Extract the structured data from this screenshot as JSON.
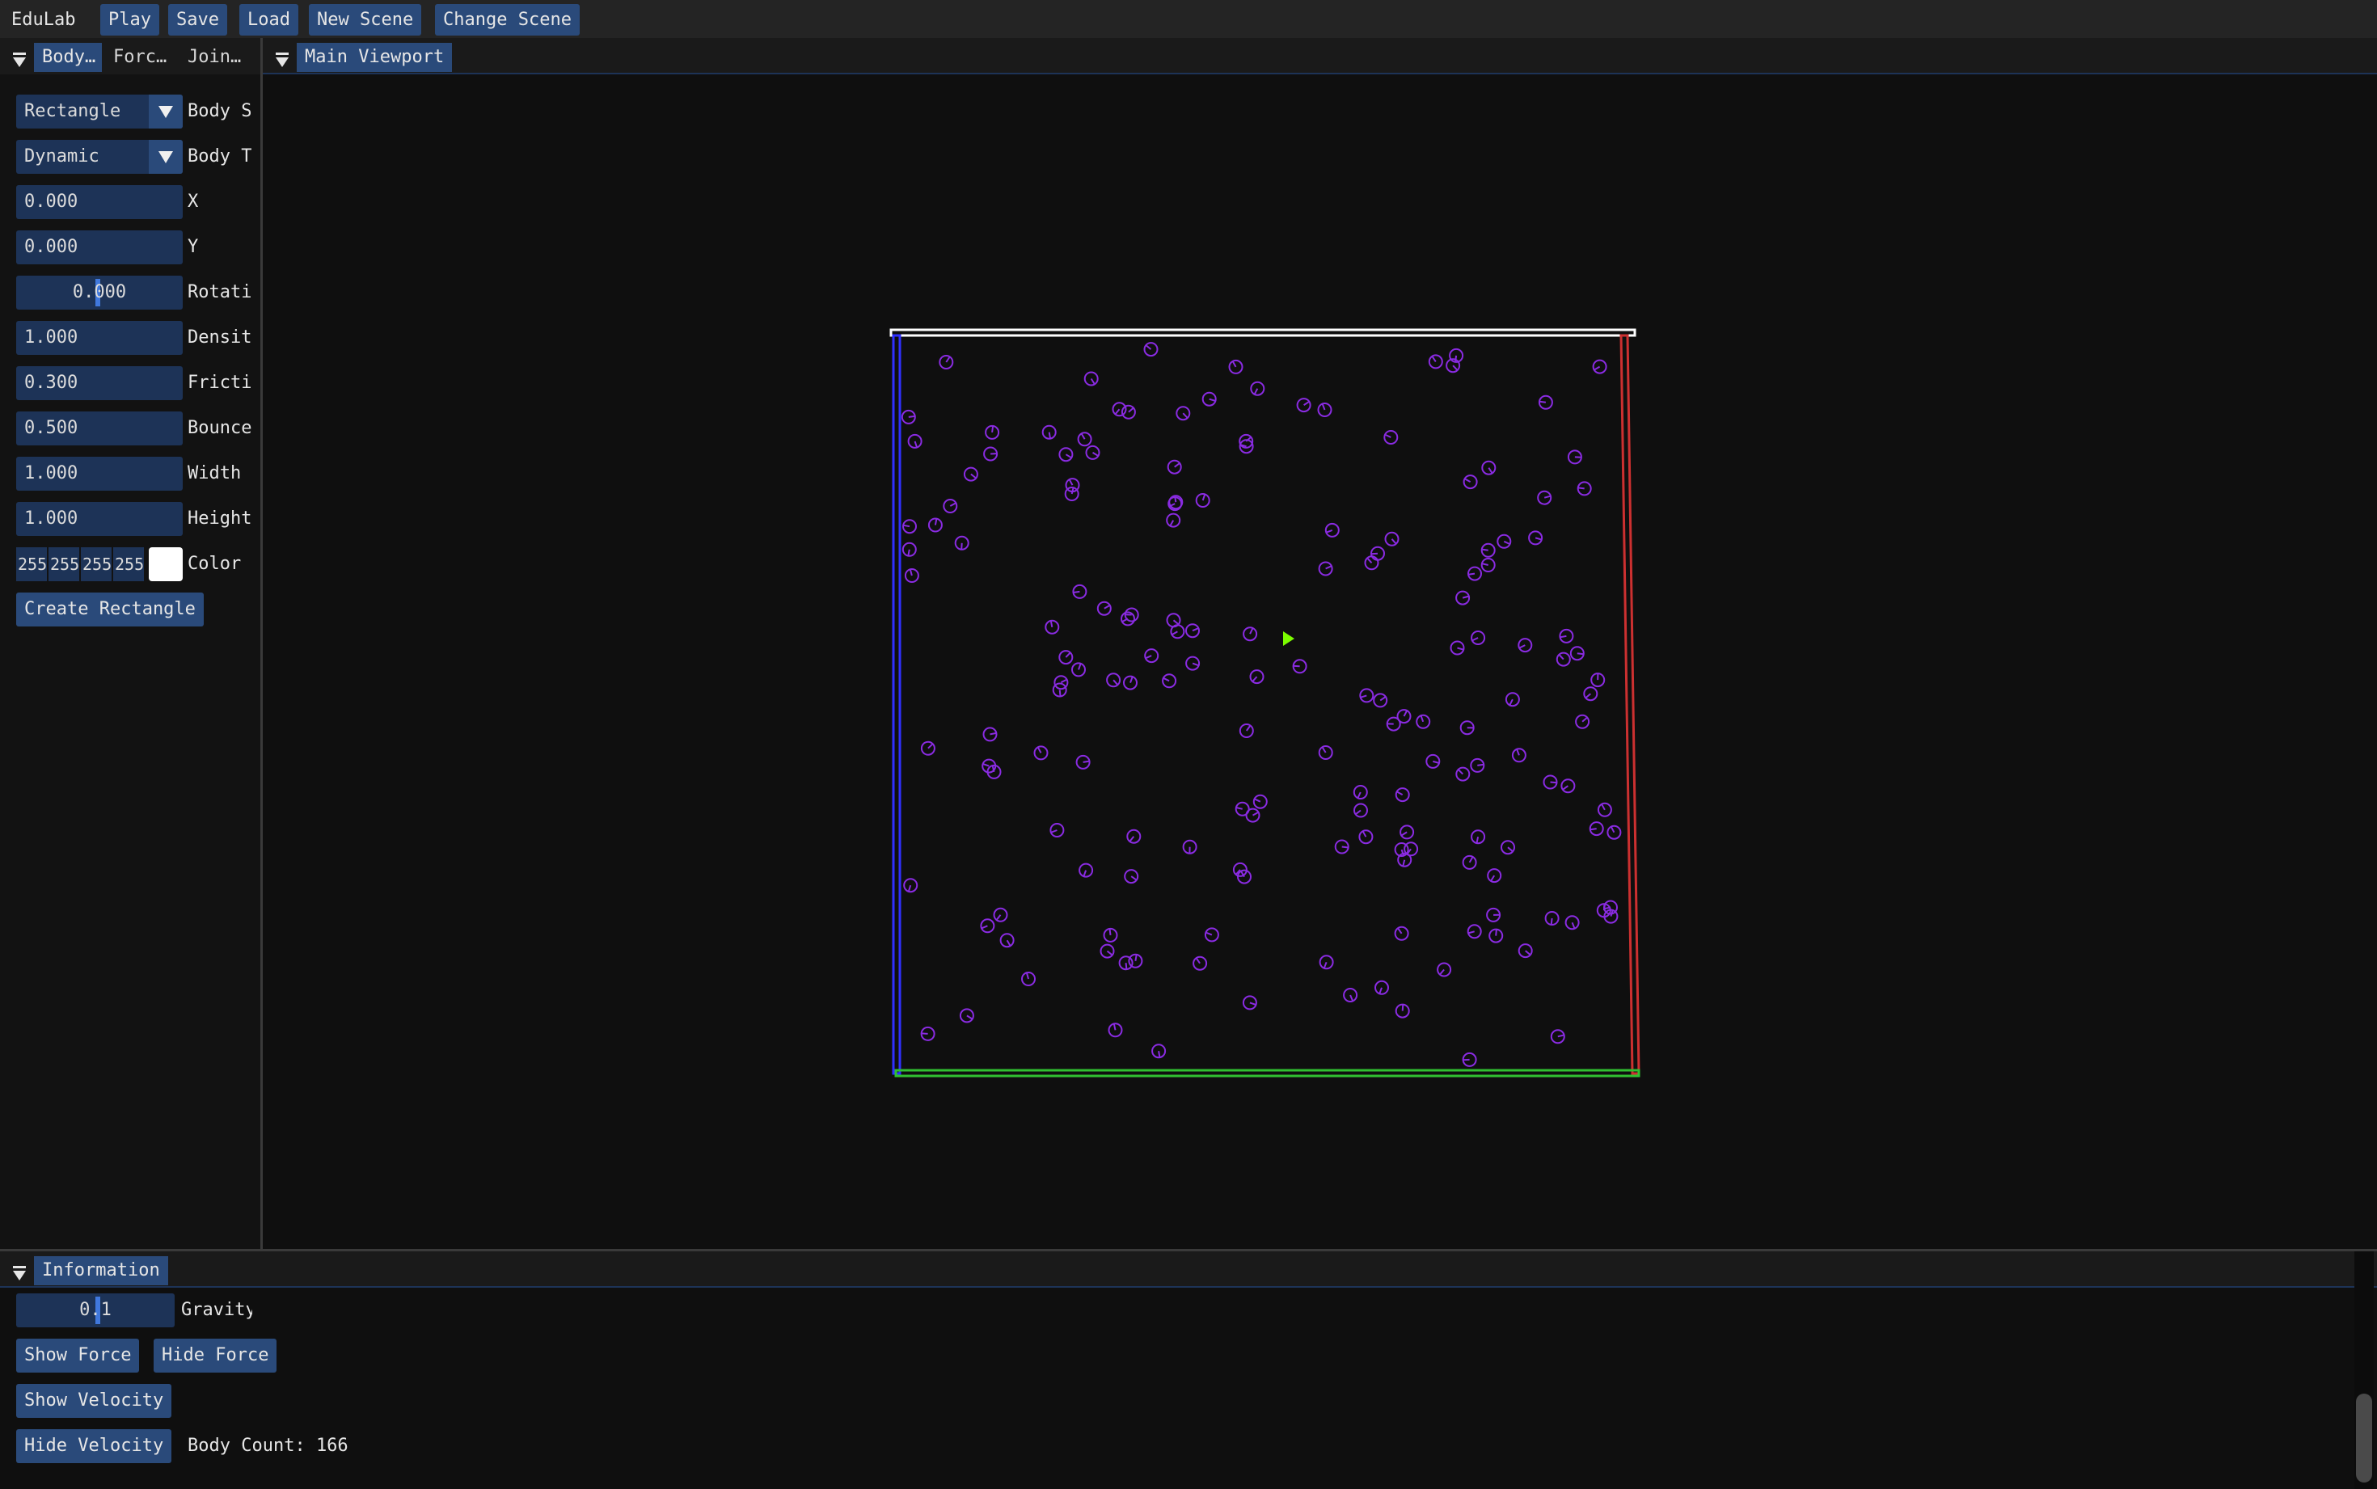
{
  "menubar": {
    "app_title": "EduLab",
    "buttons": [
      "Play",
      "Save",
      "Load",
      "New Scene",
      "Change Scene"
    ]
  },
  "left_panel": {
    "tabs": [
      "Body…",
      "Forc…",
      "Join…"
    ],
    "shape_combo": {
      "value": "Rectangle",
      "label": "Body S"
    },
    "type_combo": {
      "value": "Dynamic",
      "label": "Body T"
    },
    "fields": [
      {
        "value": "0.000",
        "label": "X"
      },
      {
        "value": "0.000",
        "label": "Y"
      },
      {
        "value": "0.000",
        "label": "Rotati"
      },
      {
        "value": "1.000",
        "label": "Densit"
      },
      {
        "value": "0.300",
        "label": "Fricti"
      },
      {
        "value": "0.500",
        "label": "Bounce"
      },
      {
        "value": "1.000",
        "label": "Width"
      },
      {
        "value": "1.000",
        "label": "Height"
      }
    ],
    "color": {
      "r": "255",
      "g": "255",
      "b": "255",
      "a": "255",
      "label": "Color",
      "swatch": "#ffffff"
    },
    "create_button": "Create Rectangle"
  },
  "viewport": {
    "tab_label": "Main Viewport",
    "body_color": "#8a2be2",
    "wall_colors": {
      "top": "#ffffff",
      "left": "#3030ff",
      "right": "#cc3030",
      "bottom": "#30c030"
    },
    "cursor_color": "#7cfc00"
  },
  "info_panel": {
    "tab_label": "Information",
    "gravity": {
      "value": "0.1",
      "label": "Gravity"
    },
    "buttons": {
      "show_force": "Show Force",
      "hide_force": "Hide Force",
      "show_velocity": "Show Velocity",
      "hide_velocity": "Hide Velocity"
    },
    "body_count": "Body Count: 166"
  },
  "colors": {
    "accent": "#2a4a7a",
    "field_bg": "#1d3357",
    "bg": "#0f0f0f"
  }
}
